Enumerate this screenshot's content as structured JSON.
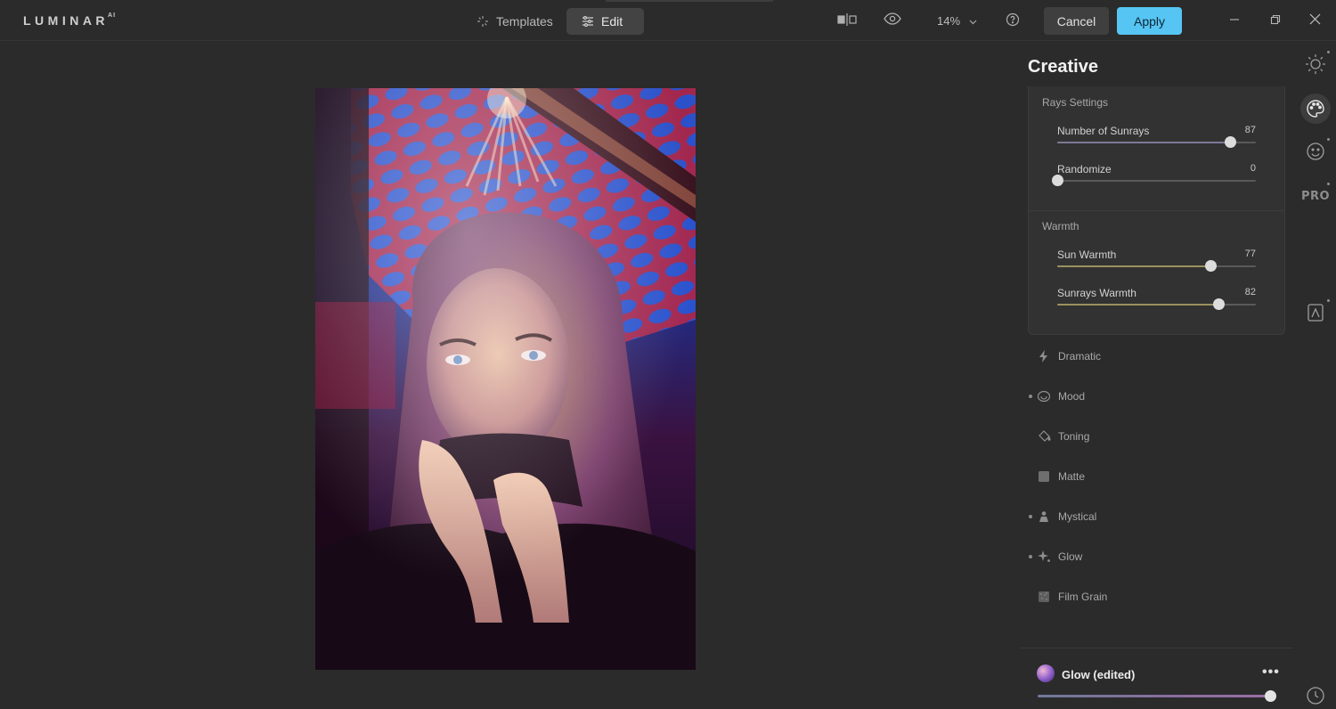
{
  "app": {
    "logo_text": "LUMINAR",
    "logo_suffix": "AI"
  },
  "topbar": {
    "tabs": [
      {
        "label": "Templates",
        "icon": "sparkle-icon",
        "active": false
      },
      {
        "label": "Edit",
        "icon": "sliders-icon",
        "active": true
      }
    ],
    "zoom_label": "14%",
    "cancel_label": "Cancel",
    "apply_label": "Apply",
    "accent_color": "#56c5f3"
  },
  "panel": {
    "title": "Creative",
    "rays_section": {
      "label": "Rays Settings",
      "sliders": [
        {
          "label": "Number of Sunrays",
          "value": 87,
          "fraction": 0.87,
          "fill_color": "#7c7a97"
        },
        {
          "label": "Randomize",
          "value": 0,
          "fraction": 0.0,
          "fill_color": "#5a5a5a"
        }
      ]
    },
    "warmth_section": {
      "label": "Warmth",
      "sliders": [
        {
          "label": "Sun Warmth",
          "value": 77,
          "fraction": 0.77,
          "fill_color": "#9a915f"
        },
        {
          "label": "Sunrays Warmth",
          "value": 82,
          "fraction": 0.81,
          "fill_color": "#9a915f"
        }
      ]
    },
    "tools": [
      {
        "label": "Dramatic",
        "icon": "lightning-icon",
        "dot": false
      },
      {
        "label": "Mood",
        "icon": "mood-icon",
        "dot": true
      },
      {
        "label": "Toning",
        "icon": "bucket-icon",
        "dot": false
      },
      {
        "label": "Matte",
        "icon": "matte-icon",
        "dot": false
      },
      {
        "label": "Mystical",
        "icon": "mystical-icon",
        "dot": true
      },
      {
        "label": "Glow",
        "icon": "glow-icon",
        "dot": true
      },
      {
        "label": "Film Grain",
        "icon": "grain-icon",
        "dot": false
      }
    ],
    "preset": {
      "name": "Glow (edited)",
      "more_label": "•••",
      "amount_fraction": 0.996
    }
  },
  "rail": {
    "icons": [
      "essentials-sun-icon",
      "creative-palette-icon",
      "portrait-face-icon",
      "pro-icon",
      "local-masking-icon",
      "history-clock-icon"
    ],
    "pro_label": "PRO"
  }
}
